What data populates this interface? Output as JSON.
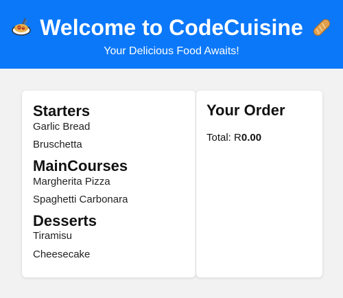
{
  "header": {
    "title": "Welcome to CodeCuisine",
    "subtitle": "Your Delicious Food Awaits!",
    "left_icon": "spaghetti-emoji",
    "right_icon": "bread-emoji",
    "background": "#0b78fa"
  },
  "menu": {
    "sections": [
      {
        "title": "Starters",
        "items": [
          "Garlic Bread",
          "Bruschetta"
        ]
      },
      {
        "title": "MainCourses",
        "items": [
          "Margherita Pizza",
          "Spaghetti Carbonara"
        ]
      },
      {
        "title": "Desserts",
        "items": [
          "Tiramisu",
          "Cheesecake"
        ]
      }
    ]
  },
  "order": {
    "title": "Your Order",
    "total_label": "Total: R",
    "total_value": "0.00"
  }
}
